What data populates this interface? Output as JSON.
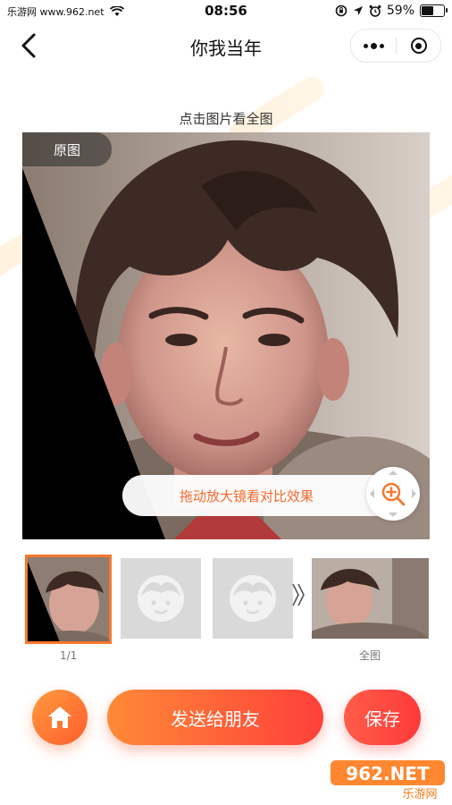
{
  "status_bar": {
    "carrier": "乐游网 www.962.net",
    "time": "08:56",
    "battery": "59%",
    "battery_level": 0.59
  },
  "nav": {
    "title": "你我当年"
  },
  "hint_top": "点击图片看全图",
  "photo": {
    "badge": "原图",
    "magnifier_tip": "拖动放大镜看对比效果"
  },
  "thumbnails": {
    "page_label": "1/1",
    "full_label": "全图"
  },
  "actions": {
    "send_label": "发送给朋友",
    "save_label": "保存"
  },
  "watermark": {
    "brand": "962.NET",
    "sub": "乐游网"
  },
  "colors": {
    "accent": "#f5792d",
    "button_red": "#ff3f3a"
  }
}
